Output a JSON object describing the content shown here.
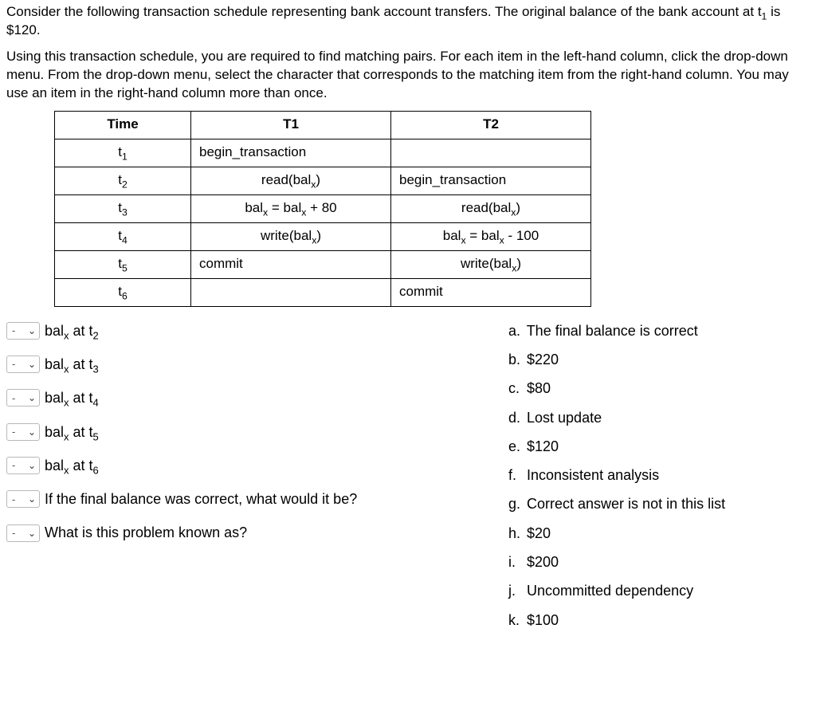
{
  "intro": {
    "p1_a": "Consider the following transaction schedule representing bank account transfers. The original balance of the bank account at t",
    "p1_sub": "1",
    "p1_b": " is $120.",
    "p2": "Using this transaction schedule, you are required to find matching pairs. For each item in the left-hand column, click the drop-down menu. From the drop-down menu, select the character that corresponds to the matching item from the right-hand column. You may use an item in the right-hand column more than once."
  },
  "schedule": {
    "headers": {
      "time": "Time",
      "t1": "T1",
      "t2": "T2"
    },
    "rows": [
      {
        "time_base": "t",
        "time_sub": "1",
        "t1": "begin_transaction",
        "t1_align": "al",
        "t2": ""
      },
      {
        "time_base": "t",
        "time_sub": "2",
        "t1_pre": "read(bal",
        "t1_sub": "x",
        "t1_post": ")",
        "t2": "begin_transaction",
        "t2_align": "al"
      },
      {
        "time_base": "t",
        "time_sub": "3",
        "t1_pre": "bal",
        "t1_sub": "x",
        "t1_mid": " = bal",
        "t1_sub2": "x",
        "t1_post": " + 80",
        "t2_pre": "read(bal",
        "t2_sub": "x",
        "t2_post": ")"
      },
      {
        "time_base": "t",
        "time_sub": "4",
        "t1_pre": "write(bal",
        "t1_sub": "x",
        "t1_post": ")",
        "t2_pre": "bal",
        "t2_sub": "x",
        "t2_mid": " = bal",
        "t2_sub2": "x",
        "t2_post": " - 100"
      },
      {
        "time_base": "t",
        "time_sub": "5",
        "t1": "commit",
        "t1_align": "al",
        "t2_pre": "write(bal",
        "t2_sub": "x",
        "t2_post": ")"
      },
      {
        "time_base": "t",
        "time_sub": "6",
        "t1": "",
        "t2": "commit",
        "t2_align": "al"
      }
    ]
  },
  "select_placeholder": "-",
  "questions": [
    {
      "pre": "bal",
      "sub1": "x",
      "mid": " at t",
      "sub2": "2"
    },
    {
      "pre": "bal",
      "sub1": "x",
      "mid": " at t",
      "sub2": "3"
    },
    {
      "pre": "bal",
      "sub1": "x",
      "mid": " at t",
      "sub2": "4"
    },
    {
      "pre": "bal",
      "sub1": "x",
      "mid": " at t",
      "sub2": "5"
    },
    {
      "pre": "bal",
      "sub1": "x",
      "mid": " at t",
      "sub2": "6"
    },
    {
      "text": "If the final balance was correct, what would it be?"
    },
    {
      "text": "What is this problem known as?"
    }
  ],
  "answers": [
    {
      "letter": "a.",
      "text": "The final balance is correct"
    },
    {
      "letter": "b.",
      "text": "$220"
    },
    {
      "letter": "c.",
      "text": "$80"
    },
    {
      "letter": "d.",
      "text": "Lost update"
    },
    {
      "letter": "e.",
      "text": "$120"
    },
    {
      "letter": "f.",
      "text": "Inconsistent analysis"
    },
    {
      "letter": "g.",
      "text": "Correct answer is not in this list"
    },
    {
      "letter": "h.",
      "text": "$20"
    },
    {
      "letter": "i.",
      "text": "$200"
    },
    {
      "letter": "j.",
      "text": "Uncommitted dependency"
    },
    {
      "letter": "k.",
      "text": "$100"
    }
  ]
}
